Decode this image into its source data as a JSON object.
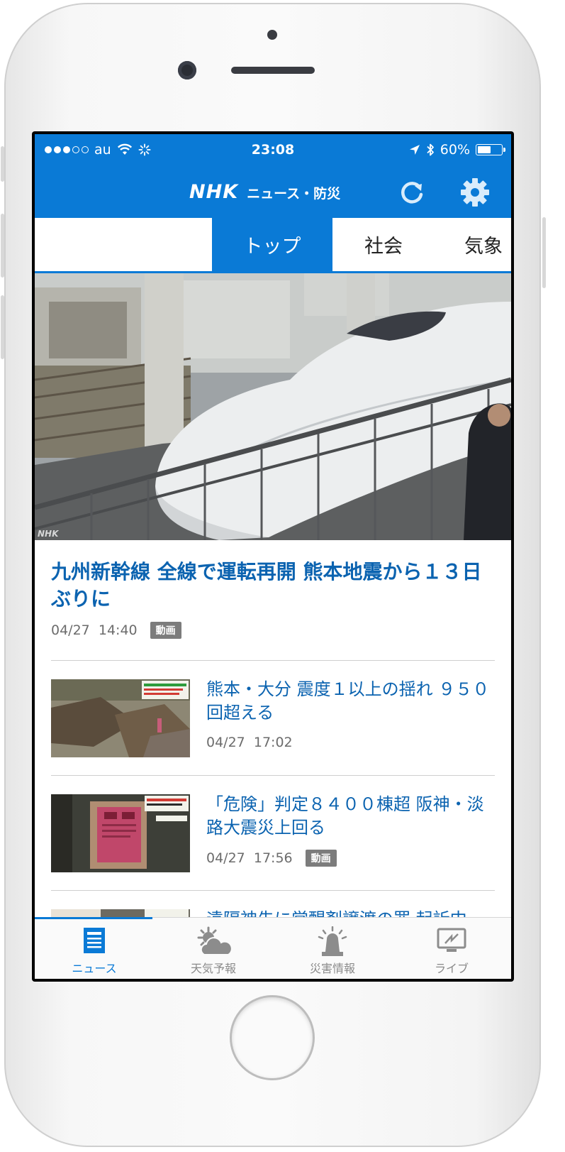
{
  "status_bar": {
    "carrier": "au",
    "time": "23:08",
    "battery_percent": "60%",
    "battery_level": 0.6
  },
  "header": {
    "logo_text": "NHK",
    "app_name": "ニュース・防災",
    "refresh_icon": "refresh-icon",
    "settings_icon": "gear-icon"
  },
  "category_tabs": [
    {
      "label": "",
      "active": false
    },
    {
      "label": "トップ",
      "active": true
    },
    {
      "label": "社会",
      "active": false
    },
    {
      "label": "気象",
      "active": false
    }
  ],
  "hero": {
    "credit": "NHK"
  },
  "featured": {
    "title": "九州新幹線 全線で運転再開 熊本地震から１３日ぶりに",
    "date": "04/27",
    "time": "14:40",
    "badge": "動画"
  },
  "news_items": [
    {
      "title": "熊本・大分 震度１以上の揺れ ９５０回超える",
      "date": "04/27",
      "time": "17:02",
      "badge": ""
    },
    {
      "title": "「危険」判定８４００棟超 阪神・淡路大震災上回る",
      "date": "04/27",
      "time": "17:56",
      "badge": "動画"
    },
    {
      "title": "遠隔神先に覚醒剤譲渡の罪 起訴中",
      "date": "",
      "time": "",
      "badge": ""
    }
  ],
  "bottom_tabs": [
    {
      "label": "ニュース",
      "icon": "newspaper-icon",
      "active": true
    },
    {
      "label": "天気予報",
      "icon": "weather-icon",
      "active": false
    },
    {
      "label": "災害情報",
      "icon": "alert-siren-icon",
      "active": false
    },
    {
      "label": "ライブ",
      "icon": "live-tv-icon",
      "active": false
    }
  ],
  "colors": {
    "brand_blue": "#0a7ad6",
    "headline_blue": "#0b63b0",
    "meta_gray": "#6c6c6c",
    "badge_gray": "#7c7c7c"
  }
}
